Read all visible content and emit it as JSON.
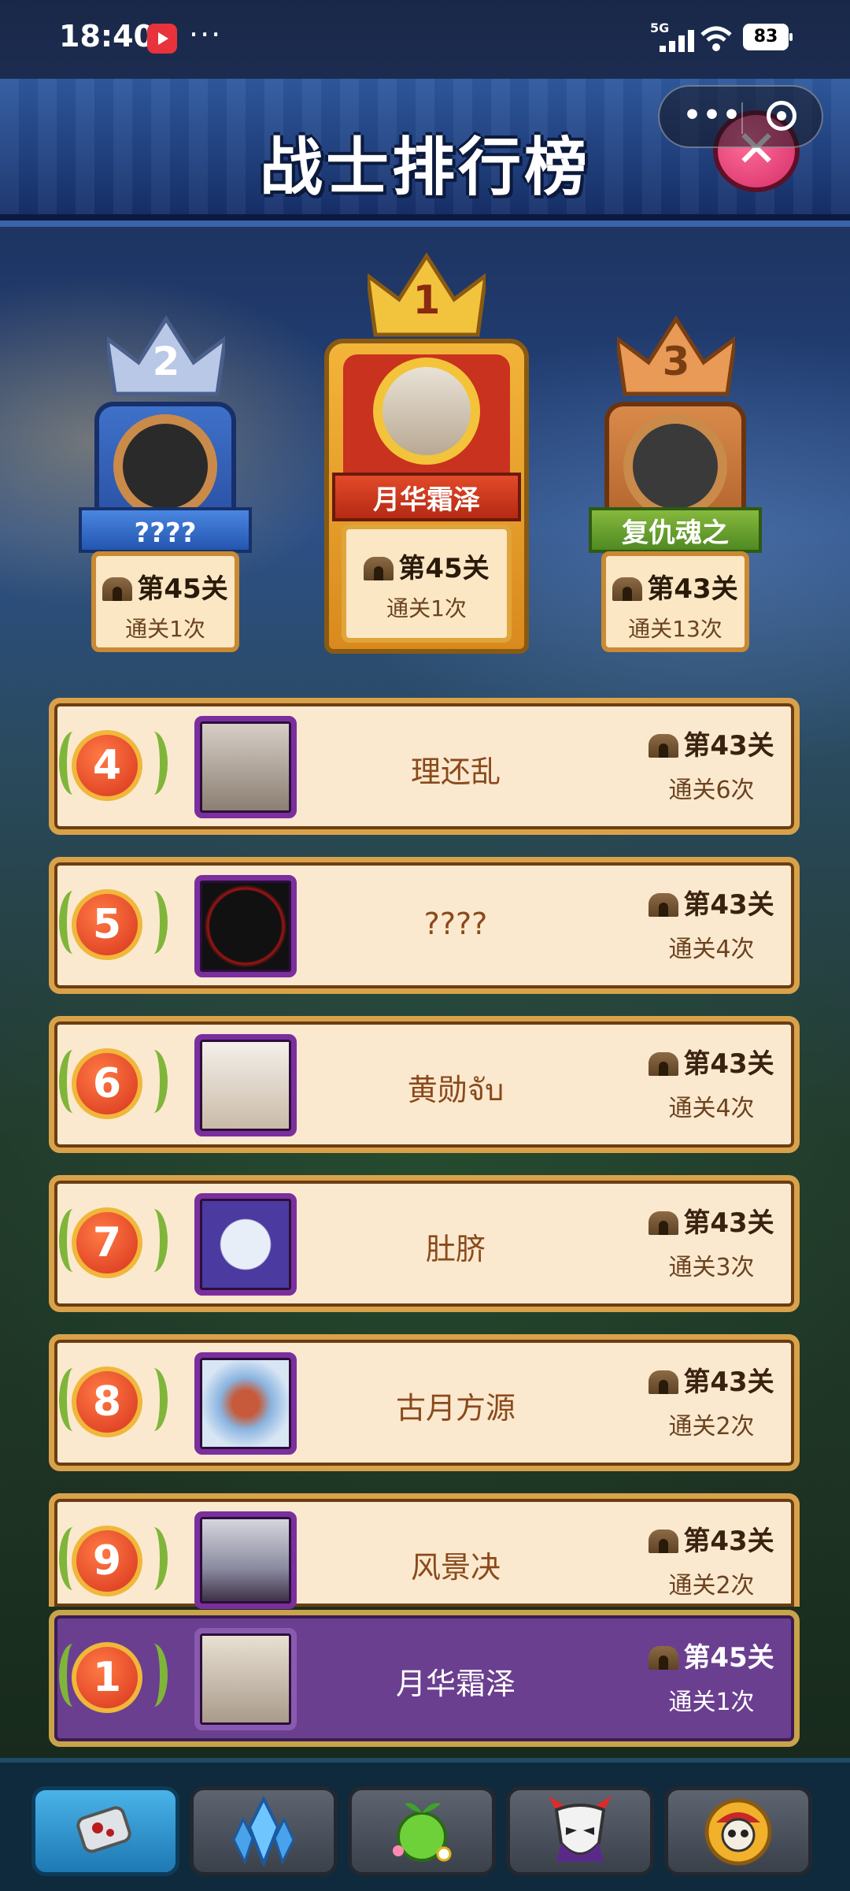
{
  "status_bar": {
    "time": "18:40",
    "more": "···",
    "network": "5G",
    "battery": "83"
  },
  "header": {
    "title": "战士排行榜",
    "capsule_more": "•••",
    "close_symbol": "✕"
  },
  "podium": [
    {
      "rank": "1",
      "name": "月华霜泽",
      "stage": "第45关",
      "clears": "通关1次"
    },
    {
      "rank": "2",
      "name": "????",
      "stage": "第45关",
      "clears": "通关1次"
    },
    {
      "rank": "3",
      "name": "复仇魂之",
      "stage": "第43关",
      "clears": "通关13次"
    }
  ],
  "rankings": [
    {
      "rank": "4",
      "name": "理还乱",
      "stage": "第43关",
      "clears": "通关6次"
    },
    {
      "rank": "5",
      "name": "????",
      "stage": "第43关",
      "clears": "通关4次"
    },
    {
      "rank": "6",
      "name": "黄勋จับ",
      "stage": "第43关",
      "clears": "通关4次"
    },
    {
      "rank": "7",
      "name": "肚脐",
      "stage": "第43关",
      "clears": "通关3次"
    },
    {
      "rank": "8",
      "name": "古月方源",
      "stage": "第43关",
      "clears": "通关2次"
    },
    {
      "rank": "9",
      "name": "风景决",
      "stage": "第43关",
      "clears": "通关2次"
    }
  ],
  "my_rank": {
    "rank": "1",
    "name": "月华霜泽",
    "stage": "第45关",
    "clears": "通关1次"
  },
  "bottom_nav": [
    {
      "icon": "dog-tag-icon",
      "active": true
    },
    {
      "icon": "crystal-icon",
      "active": false
    },
    {
      "icon": "fruit-icon",
      "active": false
    },
    {
      "icon": "demon-mask-icon",
      "active": false
    },
    {
      "icon": "pirate-skull-icon",
      "active": false
    }
  ],
  "colors": {
    "gold": "#d9a24a",
    "purple": "#6b3f8f",
    "card": "#fbe9cf",
    "medal": "#d7341c"
  }
}
